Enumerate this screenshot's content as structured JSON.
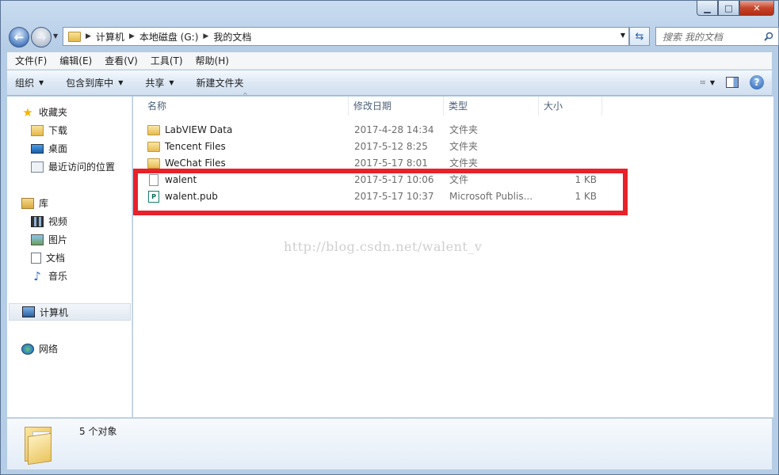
{
  "window": {
    "caption_buttons": [
      "minimize",
      "maximize",
      "close"
    ]
  },
  "address_bar": {
    "crumbs": [
      "计算机",
      "本地磁盘 (G:)",
      "我的文档"
    ],
    "search_placeholder": "搜索 我的文档"
  },
  "menu": [
    "文件(F)",
    "编辑(E)",
    "查看(V)",
    "工具(T)",
    "帮助(H)"
  ],
  "toolbar": {
    "organize": "组织",
    "include_in_library": "包含到库中",
    "share": "共享",
    "new_folder": "新建文件夹"
  },
  "nav": {
    "favorites": "收藏夹",
    "downloads": "下载",
    "desktop": "桌面",
    "recent": "最近访问的位置",
    "libraries": "库",
    "videos": "视频",
    "pictures": "图片",
    "documents": "文档",
    "music": "音乐",
    "computer": "计算机",
    "network": "网络"
  },
  "columns": {
    "name": "名称",
    "date": "修改日期",
    "type": "类型",
    "size": "大小"
  },
  "files": [
    {
      "name": "LabVIEW Data",
      "date": "2017-4-28 14:34",
      "type": "文件夹",
      "size": "",
      "icon": "folder-icon"
    },
    {
      "name": "Tencent Files",
      "date": "2017-5-12 8:25",
      "type": "文件夹",
      "size": "",
      "icon": "folder-icon"
    },
    {
      "name": "WeChat Files",
      "date": "2017-5-17 8:01",
      "type": "文件夹",
      "size": "",
      "icon": "folder-icon"
    },
    {
      "name": "walent",
      "date": "2017-5-17 10:06",
      "type": "文件",
      "size": "1 KB",
      "icon": "file-icon"
    },
    {
      "name": "walent.pub",
      "date": "2017-5-17 10:37",
      "type": "Microsoft Publis...",
      "size": "1 KB",
      "icon": "publisher-file-icon"
    }
  ],
  "watermark": "http://blog.csdn.net/walent_v",
  "details": {
    "count": "5 个对象"
  },
  "colors": {
    "highlight": "#e8212a"
  }
}
